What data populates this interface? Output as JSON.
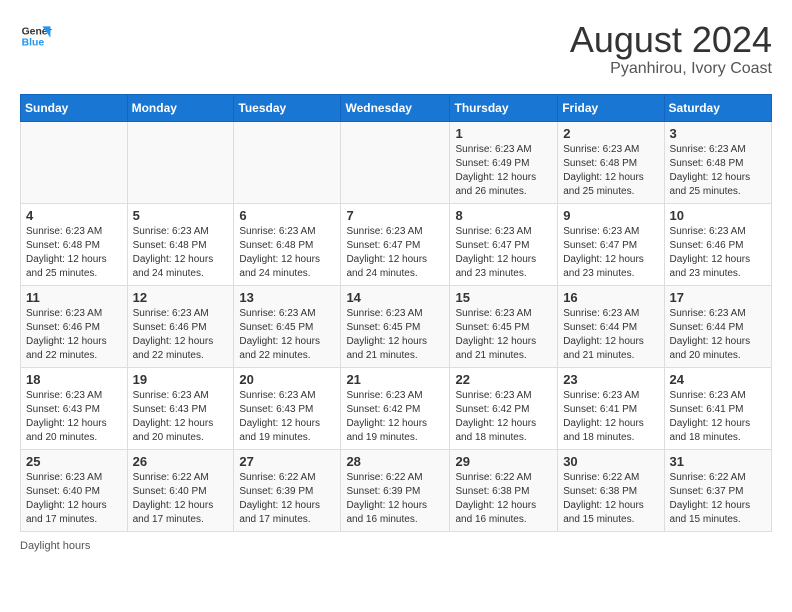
{
  "logo": {
    "line1": "General",
    "line2": "Blue"
  },
  "title": "August 2024",
  "subtitle": "Pyanhirou, Ivory Coast",
  "days_of_week": [
    "Sunday",
    "Monday",
    "Tuesday",
    "Wednesday",
    "Thursday",
    "Friday",
    "Saturday"
  ],
  "weeks": [
    [
      {
        "day": "",
        "info": ""
      },
      {
        "day": "",
        "info": ""
      },
      {
        "day": "",
        "info": ""
      },
      {
        "day": "",
        "info": ""
      },
      {
        "day": "1",
        "info": "Sunrise: 6:23 AM\nSunset: 6:49 PM\nDaylight: 12 hours and 26 minutes."
      },
      {
        "day": "2",
        "info": "Sunrise: 6:23 AM\nSunset: 6:48 PM\nDaylight: 12 hours and 25 minutes."
      },
      {
        "day": "3",
        "info": "Sunrise: 6:23 AM\nSunset: 6:48 PM\nDaylight: 12 hours and 25 minutes."
      }
    ],
    [
      {
        "day": "4",
        "info": "Sunrise: 6:23 AM\nSunset: 6:48 PM\nDaylight: 12 hours and 25 minutes."
      },
      {
        "day": "5",
        "info": "Sunrise: 6:23 AM\nSunset: 6:48 PM\nDaylight: 12 hours and 24 minutes."
      },
      {
        "day": "6",
        "info": "Sunrise: 6:23 AM\nSunset: 6:48 PM\nDaylight: 12 hours and 24 minutes."
      },
      {
        "day": "7",
        "info": "Sunrise: 6:23 AM\nSunset: 6:47 PM\nDaylight: 12 hours and 24 minutes."
      },
      {
        "day": "8",
        "info": "Sunrise: 6:23 AM\nSunset: 6:47 PM\nDaylight: 12 hours and 23 minutes."
      },
      {
        "day": "9",
        "info": "Sunrise: 6:23 AM\nSunset: 6:47 PM\nDaylight: 12 hours and 23 minutes."
      },
      {
        "day": "10",
        "info": "Sunrise: 6:23 AM\nSunset: 6:46 PM\nDaylight: 12 hours and 23 minutes."
      }
    ],
    [
      {
        "day": "11",
        "info": "Sunrise: 6:23 AM\nSunset: 6:46 PM\nDaylight: 12 hours and 22 minutes."
      },
      {
        "day": "12",
        "info": "Sunrise: 6:23 AM\nSunset: 6:46 PM\nDaylight: 12 hours and 22 minutes."
      },
      {
        "day": "13",
        "info": "Sunrise: 6:23 AM\nSunset: 6:45 PM\nDaylight: 12 hours and 22 minutes."
      },
      {
        "day": "14",
        "info": "Sunrise: 6:23 AM\nSunset: 6:45 PM\nDaylight: 12 hours and 21 minutes."
      },
      {
        "day": "15",
        "info": "Sunrise: 6:23 AM\nSunset: 6:45 PM\nDaylight: 12 hours and 21 minutes."
      },
      {
        "day": "16",
        "info": "Sunrise: 6:23 AM\nSunset: 6:44 PM\nDaylight: 12 hours and 21 minutes."
      },
      {
        "day": "17",
        "info": "Sunrise: 6:23 AM\nSunset: 6:44 PM\nDaylight: 12 hours and 20 minutes."
      }
    ],
    [
      {
        "day": "18",
        "info": "Sunrise: 6:23 AM\nSunset: 6:43 PM\nDaylight: 12 hours and 20 minutes."
      },
      {
        "day": "19",
        "info": "Sunrise: 6:23 AM\nSunset: 6:43 PM\nDaylight: 12 hours and 20 minutes."
      },
      {
        "day": "20",
        "info": "Sunrise: 6:23 AM\nSunset: 6:43 PM\nDaylight: 12 hours and 19 minutes."
      },
      {
        "day": "21",
        "info": "Sunrise: 6:23 AM\nSunset: 6:42 PM\nDaylight: 12 hours and 19 minutes."
      },
      {
        "day": "22",
        "info": "Sunrise: 6:23 AM\nSunset: 6:42 PM\nDaylight: 12 hours and 18 minutes."
      },
      {
        "day": "23",
        "info": "Sunrise: 6:23 AM\nSunset: 6:41 PM\nDaylight: 12 hours and 18 minutes."
      },
      {
        "day": "24",
        "info": "Sunrise: 6:23 AM\nSunset: 6:41 PM\nDaylight: 12 hours and 18 minutes."
      }
    ],
    [
      {
        "day": "25",
        "info": "Sunrise: 6:23 AM\nSunset: 6:40 PM\nDaylight: 12 hours and 17 minutes."
      },
      {
        "day": "26",
        "info": "Sunrise: 6:22 AM\nSunset: 6:40 PM\nDaylight: 12 hours and 17 minutes."
      },
      {
        "day": "27",
        "info": "Sunrise: 6:22 AM\nSunset: 6:39 PM\nDaylight: 12 hours and 17 minutes."
      },
      {
        "day": "28",
        "info": "Sunrise: 6:22 AM\nSunset: 6:39 PM\nDaylight: 12 hours and 16 minutes."
      },
      {
        "day": "29",
        "info": "Sunrise: 6:22 AM\nSunset: 6:38 PM\nDaylight: 12 hours and 16 minutes."
      },
      {
        "day": "30",
        "info": "Sunrise: 6:22 AM\nSunset: 6:38 PM\nDaylight: 12 hours and 15 minutes."
      },
      {
        "day": "31",
        "info": "Sunrise: 6:22 AM\nSunset: 6:37 PM\nDaylight: 12 hours and 15 minutes."
      }
    ]
  ],
  "footer": "Daylight hours"
}
